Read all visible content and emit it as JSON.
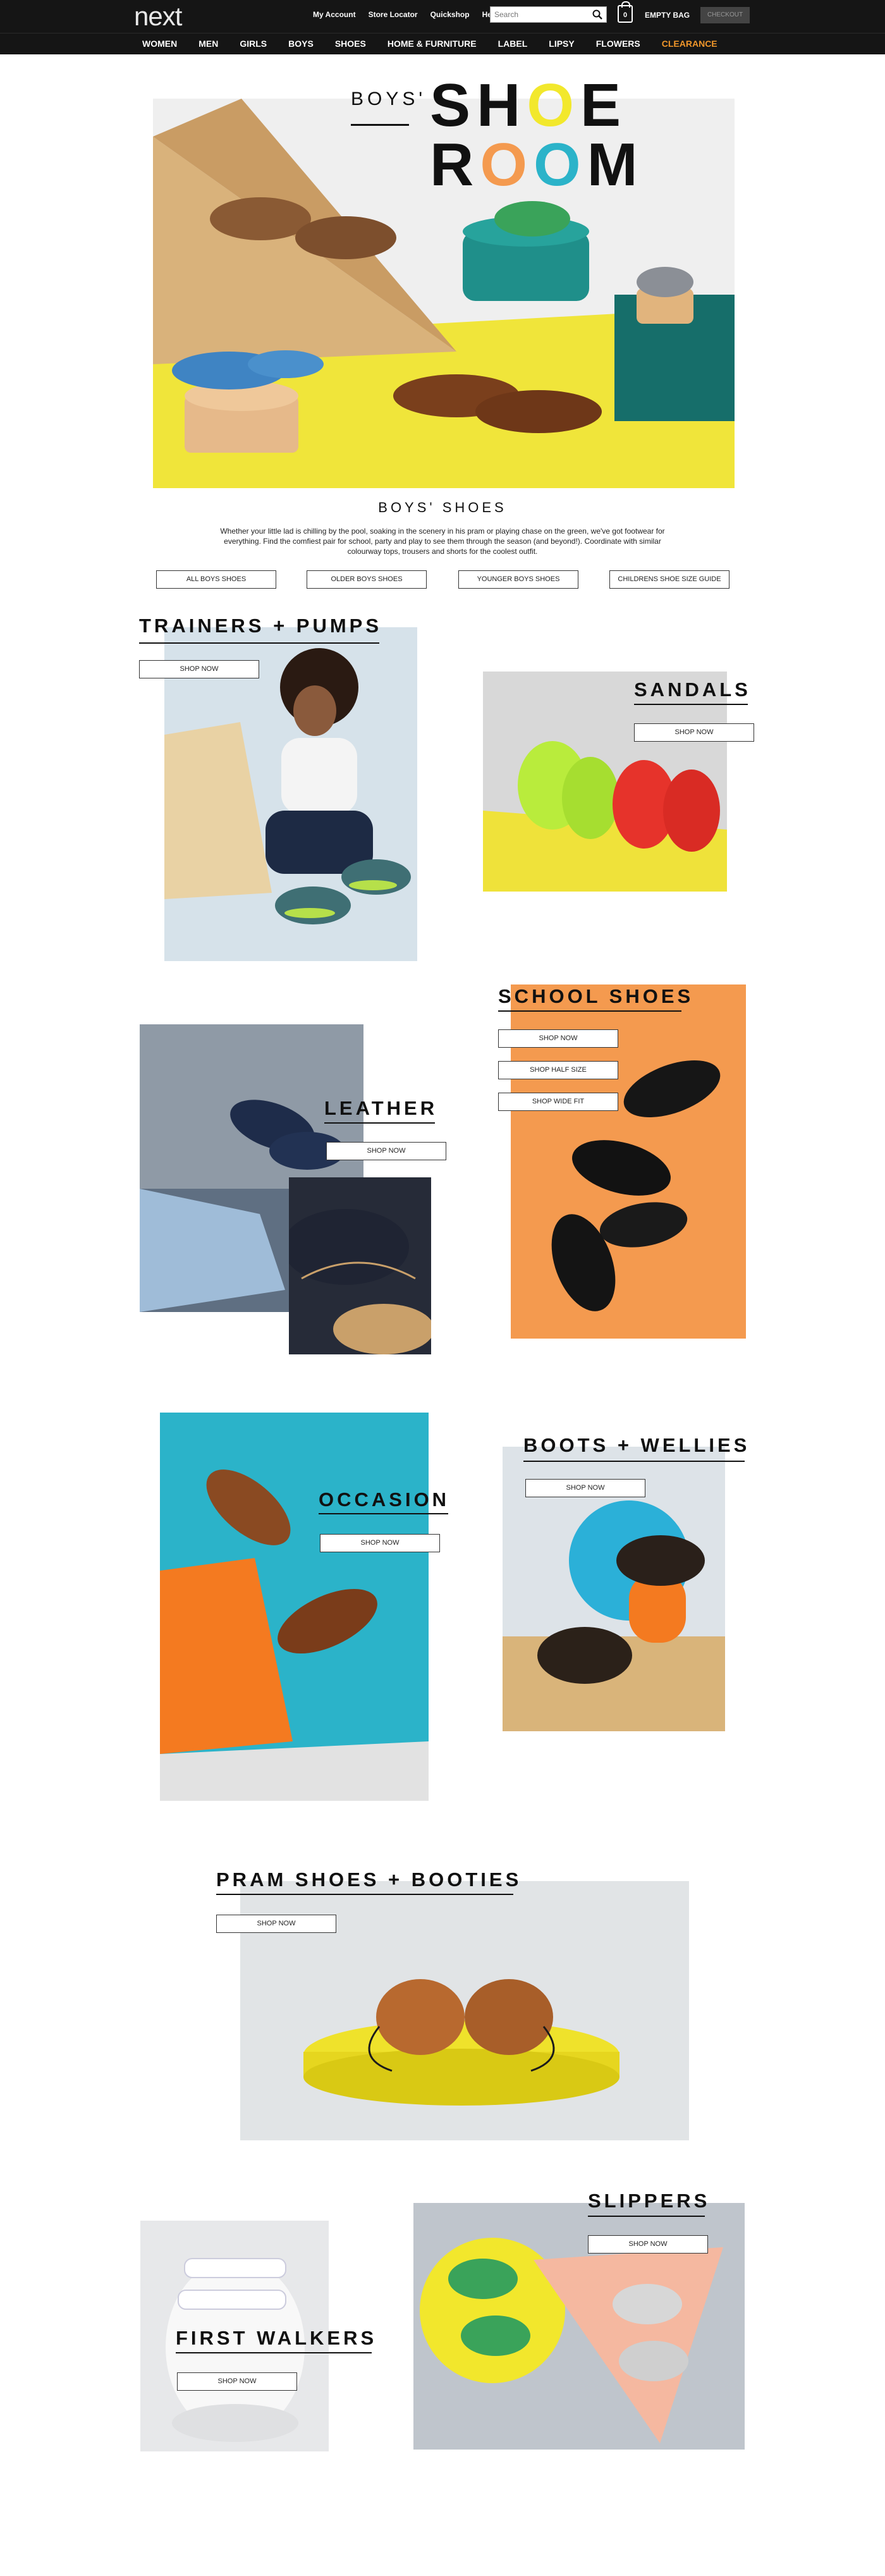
{
  "header": {
    "logo": "next",
    "links": [
      "My Account",
      "Store Locator",
      "Quickshop",
      "Help"
    ],
    "search_placeholder": "Search",
    "bag_count": "0",
    "bag_label": "EMPTY BAG",
    "checkout_label": "CHECKOUT"
  },
  "nav": [
    "WOMEN",
    "MEN",
    "GIRLS",
    "BOYS",
    "SHOES",
    "HOME & FURNITURE",
    "LABEL",
    "LIPSY",
    "FLOWERS",
    "CLEARANCE"
  ],
  "hero": {
    "word_small": "BOYS'",
    "word_line1": "SHOE",
    "word_line2": "ROOM"
  },
  "intro": {
    "title": "BOYS' SHOES",
    "text": "Whether your little lad is chilling by the pool, soaking in the scenery in his pram or playing chase on the green, we've got footwear for everything. Find the comfiest pair for school, party and play to see them through the season (and beyond!). Coordinate with similar colourway tops, trousers and shorts for the coolest outfit.",
    "buttons": [
      "ALL BOYS SHOES",
      "OLDER BOYS SHOES",
      "YOUNGER BOYS SHOES",
      "CHILDRENS SHOE SIZE GUIDE"
    ]
  },
  "categories": {
    "trainers": {
      "title": "TRAINERS + PUMPS",
      "button": "SHOP NOW"
    },
    "sandals": {
      "title": "SANDALS",
      "button": "SHOP NOW"
    },
    "school": {
      "title": "SCHOOL SHOES",
      "buttons": [
        "SHOP NOW",
        "SHOP HALF SIZE",
        "SHOP WIDE FIT"
      ]
    },
    "leather": {
      "title": "LEATHER",
      "button": "SHOP NOW"
    },
    "boots": {
      "title": "BOOTS + WELLIES",
      "button": "SHOP NOW"
    },
    "occasion": {
      "title": "OCCASION",
      "button": "SHOP NOW"
    },
    "pram": {
      "title": "PRAM SHOES + BOOTIES",
      "button": "SHOP NOW"
    },
    "slippers": {
      "title": "SLIPPERS",
      "button": "SHOP NOW"
    },
    "first_walkers": {
      "title": "FIRST WALKERS",
      "button": "SHOP NOW"
    }
  },
  "colors": {
    "header_bg": "#151515",
    "clearance": "#f0962a",
    "accent_yellow": "#f2e82c",
    "accent_orange": "#f49a4f",
    "accent_teal": "#2bb3c9"
  }
}
